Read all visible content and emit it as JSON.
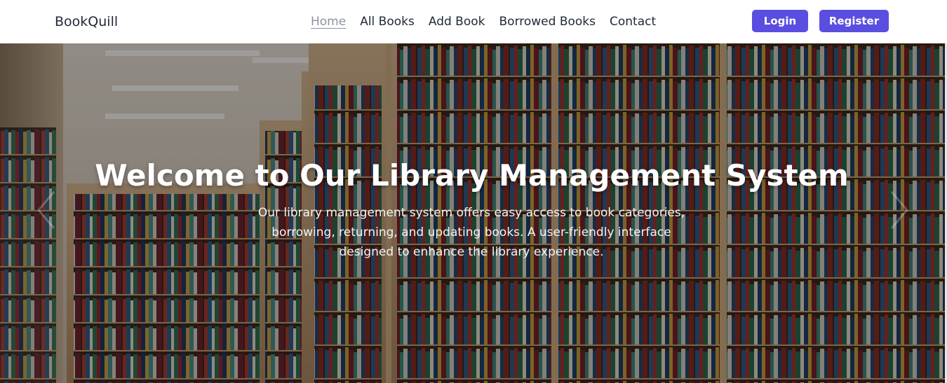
{
  "navbar": {
    "brand": "BookQuill",
    "links": [
      "Home",
      "All Books",
      "Add Book",
      "Borrowed Books",
      "Contact"
    ],
    "active_link": "Home",
    "login_label": "Login",
    "register_label": "Register"
  },
  "hero": {
    "title": "Welcome to Our Library Management System",
    "description": "Our library management system offers easy access to book categories, borrowing, returning, and updating books. A user-friendly interface designed to enhance the library experience."
  },
  "icons": {
    "prev": "chevron-left-icon",
    "next": "chevron-right-icon"
  },
  "colors": {
    "accent": "#5a4ee0",
    "active_link": "#8a92a3",
    "text_dark": "#1f2937"
  }
}
